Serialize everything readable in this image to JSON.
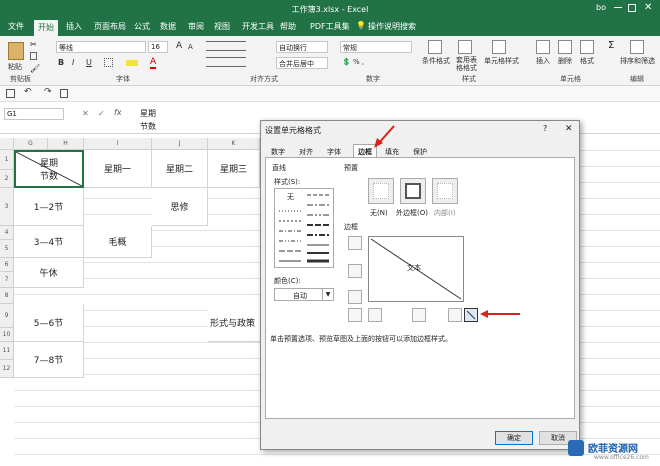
{
  "title": "工作簿3.xlsx - Excel",
  "user": "bo",
  "tabs": [
    "文件",
    "开始",
    "插入",
    "页面布局",
    "公式",
    "数据",
    "审阅",
    "视图",
    "开发工具",
    "帮助",
    "PDF工具集",
    "操作说明搜索"
  ],
  "ribbon": {
    "paste": "粘贴",
    "clipboard": "剪贴板",
    "font_name": "等线",
    "font_size": "16",
    "font_group": "字体",
    "wrap": "自动换行",
    "merge": "合并后居中",
    "align_group": "对齐方式",
    "number_format": "常规",
    "number_group": "数字",
    "cond_format": "条件格式",
    "table_format": "套用表格格式",
    "cell_style": "单元格样式",
    "style_group": "样式",
    "insert": "插入",
    "delete": "删除",
    "format": "格式",
    "cells_group": "单元格",
    "sort": "排序和筛选",
    "edit_group": "编辑",
    "bold": "B",
    "italic": "I",
    "underline": "U",
    "font_color": "A",
    "grow": "A",
    "shrink": "A"
  },
  "formula": {
    "namebox": "G1",
    "line1": "星期",
    "line2": "节数",
    "fx": "fx",
    "cancel": "✕",
    "enter": "✓"
  },
  "columns": [
    "G",
    "H",
    "I",
    "J",
    "K"
  ],
  "rows": [
    "1",
    "2",
    "3",
    "4",
    "5",
    "6",
    "7",
    "8",
    "9",
    "10",
    "11",
    "12"
  ],
  "cells": {
    "diag_top": "星期",
    "diag_bottom": "节数",
    "mon": "星期一",
    "tue": "星期二",
    "wed": "星期三",
    "p12": "1—2节",
    "p34": "3—4节",
    "lunch": "午休",
    "p56": "5—6节",
    "p78": "7—8节",
    "sixiu": "思修",
    "maogai": "毛概",
    "xingshi": "形式与政策"
  },
  "dialog": {
    "title": "设置单元格格式",
    "help": "?",
    "close": "✕",
    "tabs": [
      "数字",
      "对齐",
      "字体",
      "边框",
      "填充",
      "保护"
    ],
    "line": "直线",
    "style": "样式(S):",
    "none": "无",
    "color": "颜色(C):",
    "auto": "自动",
    "presets": "预置",
    "preset_none": "无(N)",
    "preset_outline": "外边框(O)",
    "preset_inside": "内部(I)",
    "border": "边框",
    "preview_text": "文本",
    "hint": "单击预置选项、预览草图及上面的按钮可以添加边框样式。",
    "ok": "确定",
    "cancel": "取消"
  },
  "watermark": {
    "brand": "欧菲资源网",
    "url": "www.office26.com"
  },
  "colors": {
    "excel_green": "#217346",
    "arrow_red": "#d9231f",
    "ok_blue": "#0078d7"
  }
}
